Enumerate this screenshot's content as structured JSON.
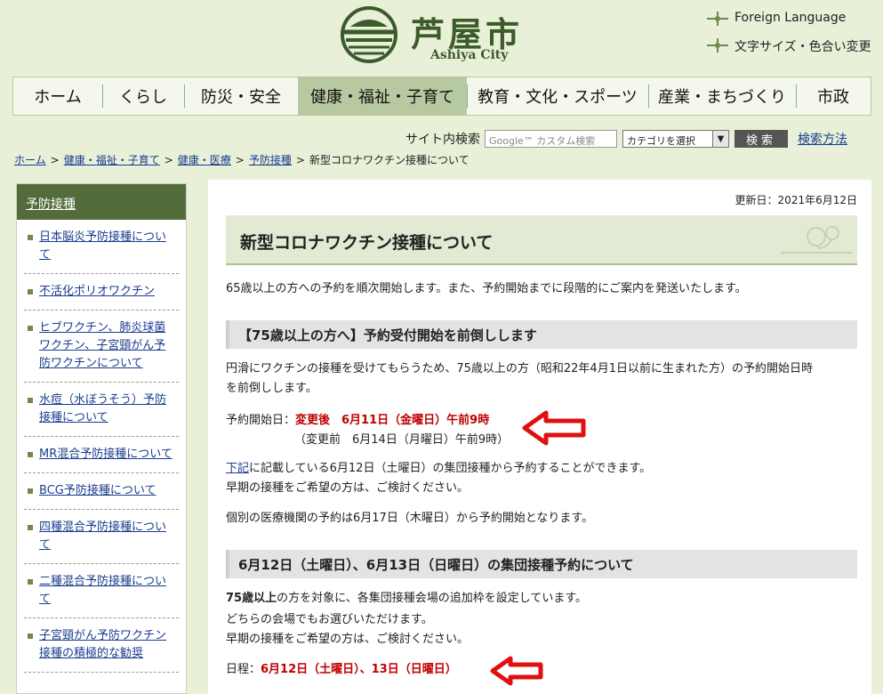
{
  "header": {
    "logo_name": "芦屋市",
    "logo_sub": "Ashiya City",
    "util_language": "Foreign Language",
    "util_fontsize": "文字サイズ・色合い変更"
  },
  "gnav": [
    {
      "label": "ホーム"
    },
    {
      "label": "くらし"
    },
    {
      "label": "防災・安全"
    },
    {
      "label": "健康・福祉・子育て"
    },
    {
      "label": "教育・文化・スポーツ"
    },
    {
      "label": "産業・まちづくり"
    },
    {
      "label": "市政"
    }
  ],
  "search": {
    "label": "サイト内検索",
    "placeholder": "Google™ カスタム検索",
    "category": "カテゴリを選択",
    "button": "検索",
    "help": "検索方法"
  },
  "breadcrumb": {
    "home": "ホーム",
    "c1": "健康・福祉・子育て",
    "c2": "健康・医療",
    "c3": "予防接種",
    "current": "新型コロナワクチン接種について"
  },
  "sidebar": {
    "title": "予防接種",
    "items": [
      {
        "label": "日本脳炎予防接種について"
      },
      {
        "label": "不活化ポリオワクチン"
      },
      {
        "label": "ヒブワクチン、肺炎球菌ワクチン、子宮頸がん予防ワクチンについて"
      },
      {
        "label": "水痘（水ぼうそう）予防接種について"
      },
      {
        "label": "MR混合予防接種について"
      },
      {
        "label": "BCG予防接種について"
      },
      {
        "label": "四種混合予防接種について"
      },
      {
        "label": "二種混合予防接種について"
      },
      {
        "label": "子宮頸がん予防ワクチン接種の積極的な勧奨"
      }
    ]
  },
  "main": {
    "updated": "更新日：2021年6月12日",
    "title": "新型コロナワクチン接種について",
    "intro": "65歳以上の方への予約を順次開始します。また、予約開始までに段階的にご案内を発送いたします。",
    "sec1": {
      "heading": "【75歳以上の方へ】予約受付開始を前倒しします",
      "p1a": "円滑にワクチンの接種を受けてもらうため、75歳以上の方（昭和22年4月1日以前に生まれた方）の予約開始日時",
      "p1b": "を前倒しします。",
      "start_label": "予約開始日：",
      "after": "変更後　6月11日（金曜日）午前9時",
      "before": "（変更前　6月14日（月曜日）午前9時）",
      "link": "下記",
      "p2a": "に記載している6月12日（土曜日）の集団接種から予約することができます。",
      "p2b": "早期の接種をご希望の方は、ご検討ください。",
      "p3": "個別の医療機関の予約は6月17日（木曜日）から予約開始となります。"
    },
    "sec2": {
      "heading": "6月12日（土曜日）、6月13日（日曜日）の集団接種予約について",
      "p1_bold": "75歳以上",
      "p1_rest": "の方を対象に、各集団接種会場の追加枠を設定しています。",
      "p2": "どちらの会場でもお選びいただけます。",
      "p3": "早期の接種をご希望の方は、ご検討ください。",
      "schedule_label": "日程：",
      "schedule": "6月12日（土曜日）、13日（日曜日）"
    }
  }
}
